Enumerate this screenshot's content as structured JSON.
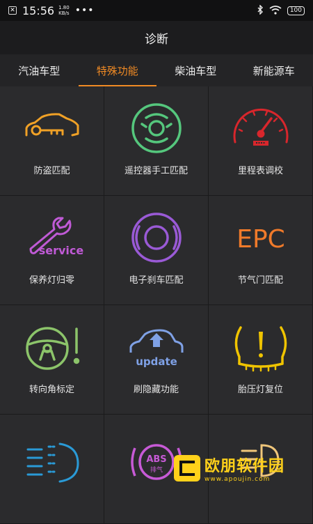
{
  "status_bar": {
    "time": "15:56",
    "speed_value": "1.80",
    "speed_unit": "KB/s",
    "dots": "•••",
    "battery": "100"
  },
  "header": {
    "title": "诊断"
  },
  "tabs": [
    {
      "label": "汽油车型",
      "active": false
    },
    {
      "label": "特殊功能",
      "active": true
    },
    {
      "label": "柴油车型",
      "active": false
    },
    {
      "label": "新能源车",
      "active": false
    }
  ],
  "grid": {
    "items": [
      {
        "label": "防盗匹配",
        "icon": "car-key-icon",
        "color": "#f0a126"
      },
      {
        "label": "遥控器手工匹配",
        "icon": "remote-steering-icon",
        "color": "#55c77d"
      },
      {
        "label": "里程表调校",
        "icon": "odometer-gauge-icon",
        "color": "#d8262c"
      },
      {
        "label": "保养灯归零",
        "icon": "wrench-service-icon",
        "color": "#c05ad6",
        "icon_text": "service"
      },
      {
        "label": "电子刹车匹配",
        "icon": "electronic-brake-icon",
        "color": "#9a5ad6"
      },
      {
        "label": "节气门匹配",
        "icon": "epc-icon",
        "color": "#f07a2a",
        "icon_text": "EPC"
      },
      {
        "label": "转向角标定",
        "icon": "steering-warning-icon",
        "color": "#8cc46a"
      },
      {
        "label": "刷隐藏功能",
        "icon": "update-car-icon",
        "color": "#7fa1e6",
        "icon_text": "update"
      },
      {
        "label": "胎压灯复位",
        "icon": "tire-pressure-icon",
        "color": "#f0c400"
      },
      {
        "label": "",
        "icon": "headlight-beam-icon",
        "color": "#2a9ad6"
      },
      {
        "label": "",
        "icon": "abs-exhaust-icon",
        "color": "#c75ad6",
        "icon_text_top": "ABS",
        "icon_text_bottom": "排气"
      },
      {
        "label": "",
        "icon": "light-icon",
        "color": "#f0c67a"
      }
    ]
  },
  "watermark": {
    "title": "欧朋软件园",
    "url": "www.apoujin.com"
  }
}
